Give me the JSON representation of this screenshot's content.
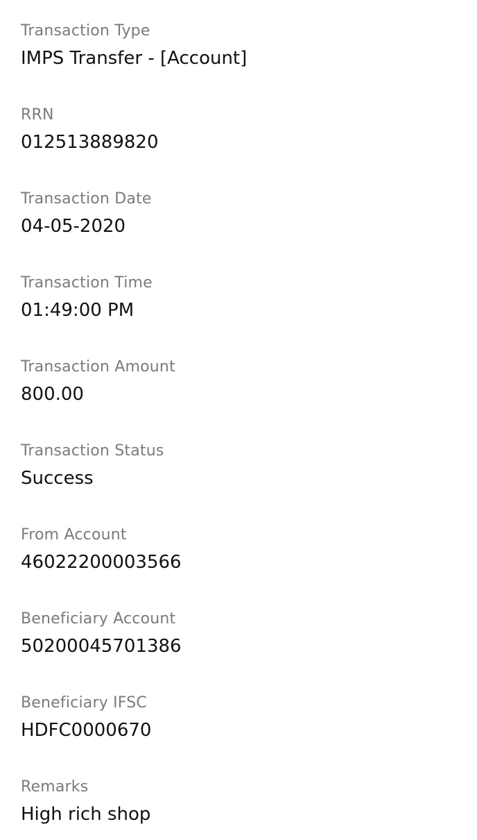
{
  "transaction_details": {
    "fields": [
      {
        "label": "Transaction Type",
        "value": "IMPS Transfer - [Account]"
      },
      {
        "label": "RRN",
        "value": "012513889820"
      },
      {
        "label": "Transaction Date",
        "value": "04-05-2020"
      },
      {
        "label": "Transaction Time",
        "value": "01:49:00 PM"
      },
      {
        "label": "Transaction Amount",
        "value": "800.00"
      },
      {
        "label": "Transaction Status",
        "value": "Success"
      },
      {
        "label": "From Account",
        "value": "46022200003566"
      },
      {
        "label": "Beneficiary Account",
        "value": "50200045701386"
      },
      {
        "label": "Beneficiary IFSC",
        "value": "HDFC0000670"
      },
      {
        "label": "Remarks",
        "value": "High rich shop"
      }
    ]
  }
}
